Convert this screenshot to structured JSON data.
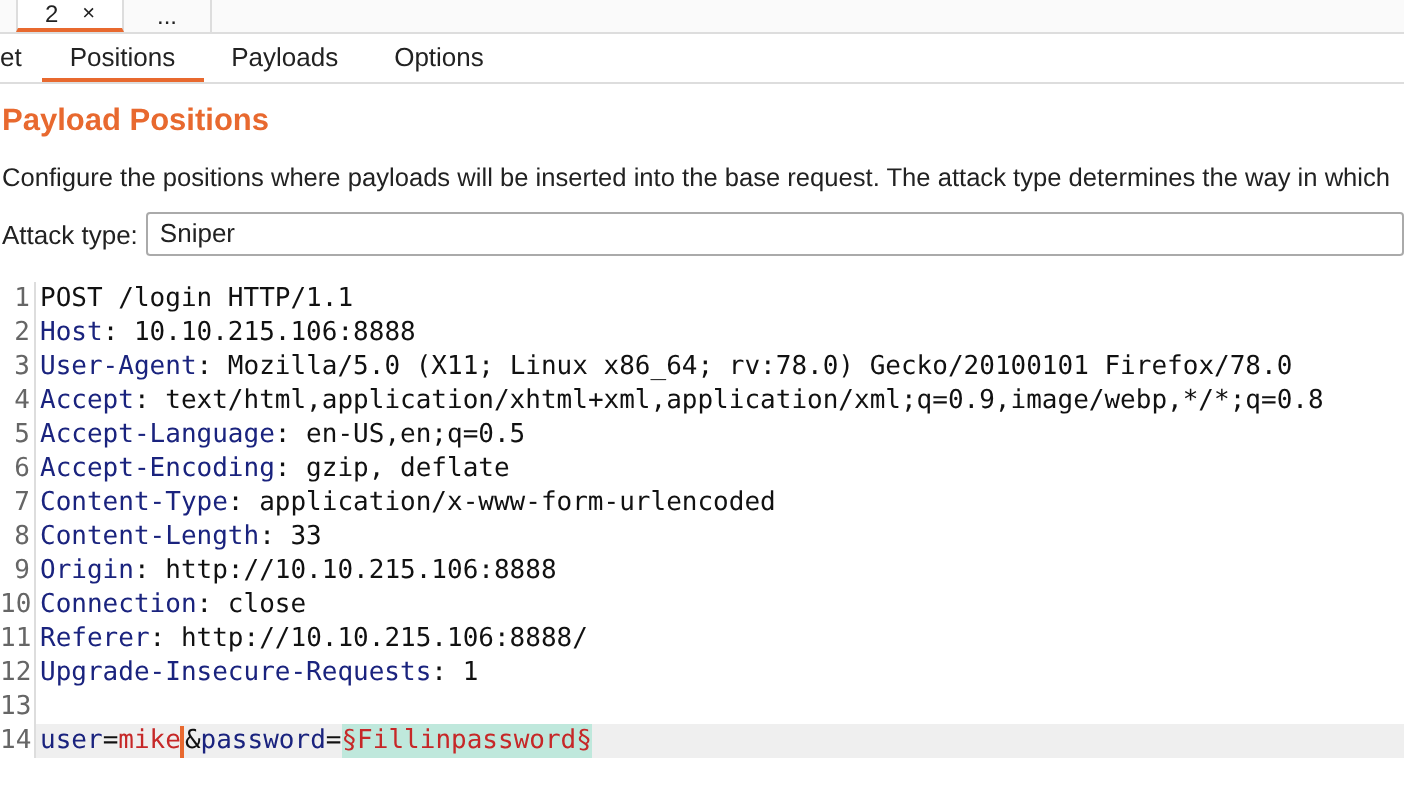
{
  "top_tabs": [
    {
      "label": "2",
      "close": "×",
      "selected": true
    },
    {
      "label": "...",
      "selected": false
    }
  ],
  "sub_tabs": [
    {
      "label": "et",
      "selected": false
    },
    {
      "label": "Positions",
      "selected": true
    },
    {
      "label": "Payloads",
      "selected": false
    },
    {
      "label": "Options",
      "selected": false
    }
  ],
  "heading": "Payload Positions",
  "description": "Configure the positions where payloads will be inserted into the base request. The attack type determines the way in which",
  "attack_type": {
    "label": "Attack type:",
    "value": "Sniper"
  },
  "editor": {
    "lines": [
      {
        "number": "1",
        "current": false,
        "segments": [
          {
            "kind": "plain",
            "text": "POST /login HTTP/1.1"
          }
        ]
      },
      {
        "number": "2",
        "current": false,
        "segments": [
          {
            "kind": "name",
            "text": "Host"
          },
          {
            "kind": "plain",
            "text": ": 10.10.215.106:8888"
          }
        ]
      },
      {
        "number": "3",
        "current": false,
        "segments": [
          {
            "kind": "name",
            "text": "User-Agent"
          },
          {
            "kind": "plain",
            "text": ": Mozilla/5.0 (X11; Linux x86_64; rv:78.0) Gecko/20100101 Firefox/78.0"
          }
        ]
      },
      {
        "number": "4",
        "current": false,
        "segments": [
          {
            "kind": "name",
            "text": "Accept"
          },
          {
            "kind": "plain",
            "text": ": text/html,application/xhtml+xml,application/xml;q=0.9,image/webp,*/*;q=0.8"
          }
        ]
      },
      {
        "number": "5",
        "current": false,
        "segments": [
          {
            "kind": "name",
            "text": "Accept-Language"
          },
          {
            "kind": "plain",
            "text": ": en-US,en;q=0.5"
          }
        ]
      },
      {
        "number": "6",
        "current": false,
        "segments": [
          {
            "kind": "name",
            "text": "Accept-Encoding"
          },
          {
            "kind": "plain",
            "text": ": gzip, deflate"
          }
        ]
      },
      {
        "number": "7",
        "current": false,
        "segments": [
          {
            "kind": "name",
            "text": "Content-Type"
          },
          {
            "kind": "plain",
            "text": ": application/x-www-form-urlencoded"
          }
        ]
      },
      {
        "number": "8",
        "current": false,
        "segments": [
          {
            "kind": "name",
            "text": "Content-Length"
          },
          {
            "kind": "plain",
            "text": ": 33"
          }
        ]
      },
      {
        "number": "9",
        "current": false,
        "segments": [
          {
            "kind": "name",
            "text": "Origin"
          },
          {
            "kind": "plain",
            "text": ": http://10.10.215.106:8888"
          }
        ]
      },
      {
        "number": "10",
        "current": false,
        "segments": [
          {
            "kind": "name",
            "text": "Connection"
          },
          {
            "kind": "plain",
            "text": ": close"
          }
        ]
      },
      {
        "number": "11",
        "current": false,
        "segments": [
          {
            "kind": "name",
            "text": "Referer"
          },
          {
            "kind": "plain",
            "text": ": http://10.10.215.106:8888/"
          }
        ]
      },
      {
        "number": "12",
        "current": false,
        "segments": [
          {
            "kind": "name",
            "text": "Upgrade-Insecure-Requests"
          },
          {
            "kind": "plain",
            "text": ": 1"
          }
        ]
      },
      {
        "number": "13",
        "current": false
      },
      {
        "number": "14",
        "current": true,
        "segments": [
          {
            "kind": "name",
            "text": "user"
          },
          {
            "kind": "plain",
            "text": "="
          },
          {
            "kind": "value",
            "text": "mike"
          },
          {
            "kind": "caret"
          },
          {
            "kind": "plain",
            "text": "&"
          },
          {
            "kind": "name",
            "text": "password"
          },
          {
            "kind": "plain",
            "text": "="
          },
          {
            "kind": "payload",
            "text": "§Fillinpassword§"
          }
        ]
      }
    ]
  }
}
